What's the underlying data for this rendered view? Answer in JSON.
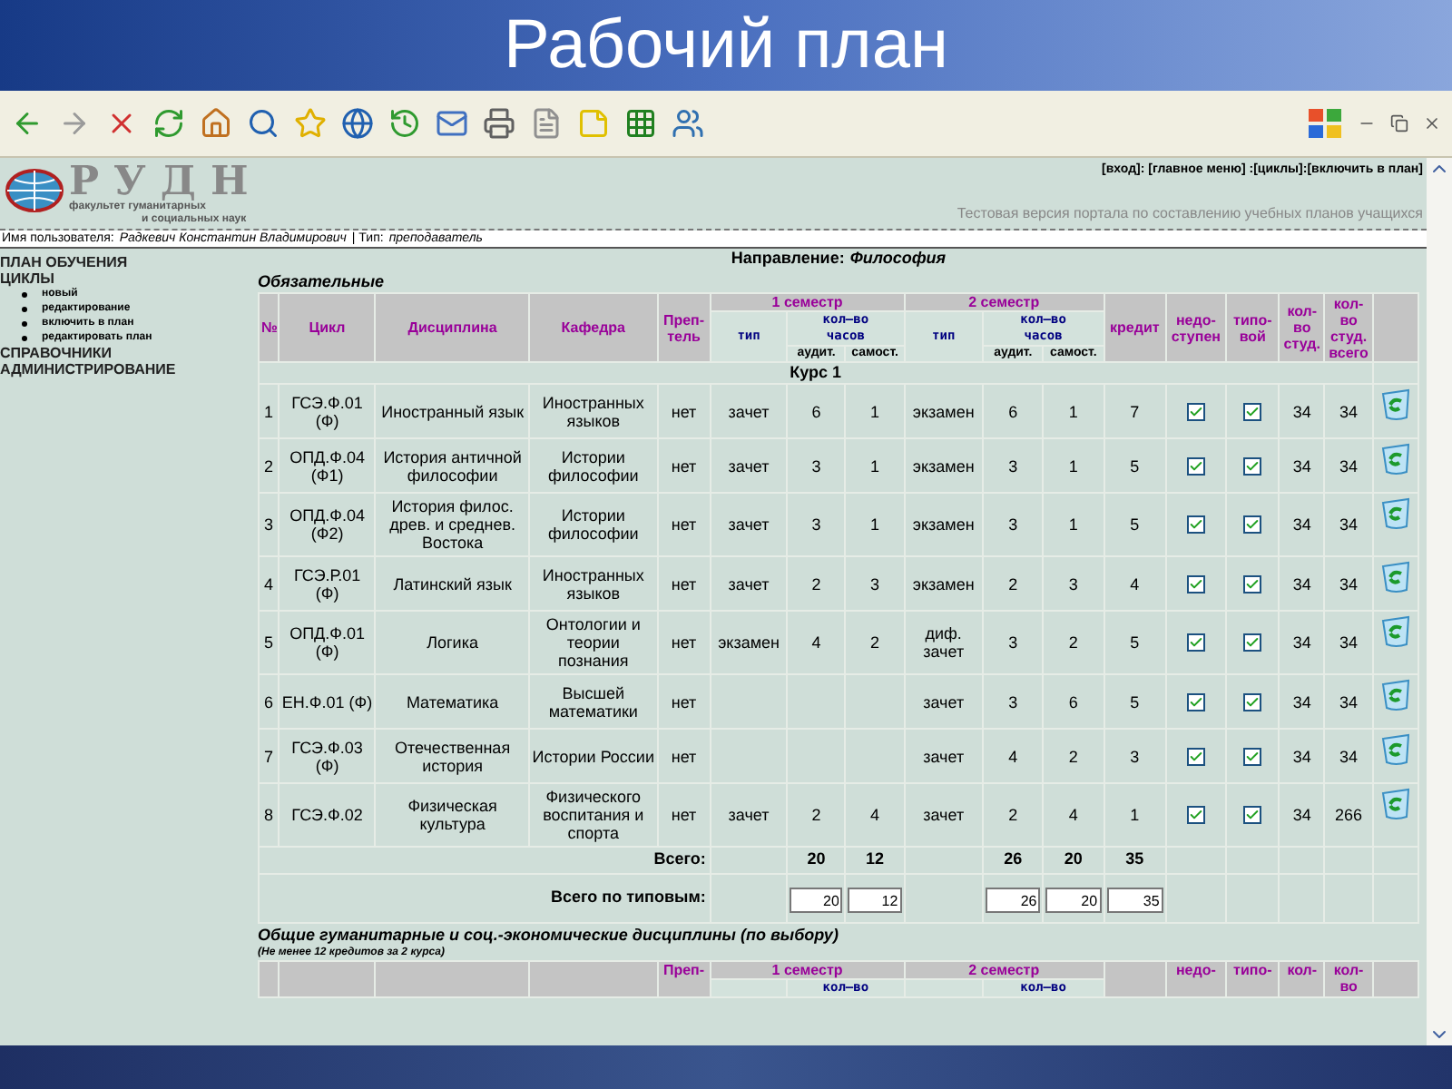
{
  "slide_title": "Рабочий план",
  "site": {
    "logo": "РУДН",
    "faculty": [
      "факультет гуманитарных",
      "и социальных наук"
    ],
    "nav": "[вход]: [главное меню] :[циклы]:[включить в план]",
    "tagline": "Тестовая версия портала по составлению учебных планов учащихся",
    "user_label": "Имя пользователя:",
    "user_name": "Радкевич Константин Владимирович",
    "type_label": "| Тип:",
    "type_value": "преподаватель"
  },
  "sidebar": [
    {
      "label": "ПЛАН ОБУЧЕНИЯ"
    },
    {
      "label": "ЦИКЛЫ",
      "children": [
        {
          "label": "новый"
        },
        {
          "label": "редактирование"
        },
        {
          "label": "включить в план"
        },
        {
          "label": "редактировать план"
        }
      ]
    },
    {
      "label": "СПРАВОЧНИКИ"
    },
    {
      "label": "АДМИНИСТРИРОВАНИЕ"
    }
  ],
  "direction_label": "Направление:",
  "direction_value": "Философия",
  "section_title": "Обязательные",
  "header": {
    "number": "№",
    "cycle": "Цикл",
    "discipline": "Дисциплина",
    "department": "Кафедра",
    "teacher": "Преп-\nтель",
    "semesters": [
      {
        "title": "1 семестр",
        "type": "тип",
        "hours": "кол–во\nчасов",
        "aud": "аудит.",
        "self": "самост."
      },
      {
        "title": "2 семестр",
        "type": "тип",
        "hours": "кол–во\nчасов",
        "aud": "аудит.",
        "self": "самост."
      }
    ],
    "credit": "кредит",
    "unavailable": "недо-\nступен",
    "typical": "типо-\nвой",
    "students": "кол-\nво\nстуд.",
    "students_total": "кол-\nво\nстуд.\nвсего"
  },
  "course": "Курс 1",
  "rows": [
    {
      "number": "1",
      "cycle": "ГСЭ.Ф.01 (Ф)",
      "discipline": "Иностранный язык",
      "department": "Иностранных языков",
      "teacher": "нет",
      "sem1": [
        "зачет",
        "6",
        "1"
      ],
      "sem2": [
        "экзамен",
        "6",
        "1"
      ],
      "credit": "7",
      "unavailable": true,
      "typical": true,
      "students": "34",
      "students_total": "34"
    },
    {
      "number": "2",
      "cycle": "ОПД.Ф.04 (Ф1)",
      "discipline": "История античной философии",
      "department": "Истории философии",
      "teacher": "нет",
      "sem1": [
        "зачет",
        "3",
        "1"
      ],
      "sem2": [
        "экзамен",
        "3",
        "1"
      ],
      "credit": "5",
      "unavailable": true,
      "typical": true,
      "students": "34",
      "students_total": "34"
    },
    {
      "number": "3",
      "cycle": "ОПД.Ф.04 (Ф2)",
      "discipline": "История филос. древ. и среднев. Востока",
      "department": "Истории философии",
      "teacher": "нет",
      "sem1": [
        "зачет",
        "3",
        "1"
      ],
      "sem2": [
        "экзамен",
        "3",
        "1"
      ],
      "credit": "5",
      "unavailable": true,
      "typical": true,
      "students": "34",
      "students_total": "34"
    },
    {
      "number": "4",
      "cycle": "ГСЭ.Р.01 (Ф)",
      "discipline": "Латинский язык",
      "department": "Иностранных языков",
      "teacher": "нет",
      "sem1": [
        "зачет",
        "2",
        "3"
      ],
      "sem2": [
        "экзамен",
        "2",
        "3"
      ],
      "credit": "4",
      "unavailable": true,
      "typical": true,
      "students": "34",
      "students_total": "34"
    },
    {
      "number": "5",
      "cycle": "ОПД.Ф.01 (Ф)",
      "discipline": "Логика",
      "department": "Онтологии и теории познания",
      "teacher": "нет",
      "sem1": [
        "экзамен",
        "4",
        "2"
      ],
      "sem2": [
        "диф. зачет",
        "3",
        "2"
      ],
      "credit": "5",
      "unavailable": true,
      "typical": true,
      "students": "34",
      "students_total": "34"
    },
    {
      "number": "6",
      "cycle": "ЕН.Ф.01 (Ф)",
      "discipline": "Математика",
      "department": "Высшей математики",
      "teacher": "нет",
      "sem1": [],
      "sem2": [
        "зачет",
        "3",
        "6"
      ],
      "credit": "5",
      "unavailable": true,
      "typical": true,
      "students": "34",
      "students_total": "34"
    },
    {
      "number": "7",
      "cycle": "ГСЭ.Ф.03 (Ф)",
      "discipline": "Отечественная история",
      "department": "Истории России",
      "teacher": "нет",
      "sem1": [],
      "sem2": [
        "зачет",
        "4",
        "2"
      ],
      "credit": "3",
      "unavailable": true,
      "typical": true,
      "students": "34",
      "students_total": "34"
    },
    {
      "number": "8",
      "cycle": "ГСЭ.Ф.02",
      "discipline": "Физическая культура",
      "department": "Физического воспитания и спорта",
      "teacher": "нет",
      "sem1": [
        "зачет",
        "2",
        "4"
      ],
      "sem2": [
        "зачет",
        "2",
        "4"
      ],
      "credit": "1",
      "unavailable": true,
      "typical": true,
      "students": "34",
      "students_total": "266"
    }
  ],
  "totals": {
    "label": "Всего:",
    "values": [
      "20",
      "12",
      "26",
      "20",
      "35"
    ]
  },
  "typical_totals": {
    "label": "Всего по типовым:",
    "values": [
      "20",
      "12",
      "26",
      "20",
      "35"
    ]
  },
  "section2": {
    "title": "Общие гуманитарные и соц.-экономические дисциплины (по выбору)",
    "note": "(Не менее 12 кредитов за 2 курса)",
    "teacher": "Преп-",
    "semesters": [
      {
        "title": "1 семестр",
        "hours": "кол–во"
      },
      {
        "title": "2 семестр",
        "hours": "кол–во"
      }
    ],
    "unavailable": "недо-",
    "typical": "типо-",
    "students": "кол-",
    "students_total": "кол-во"
  }
}
